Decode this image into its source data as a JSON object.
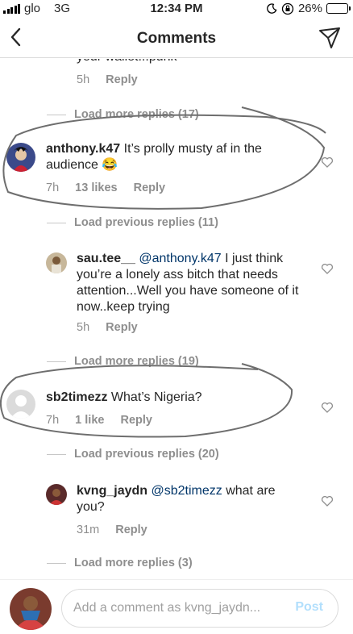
{
  "status_bar": {
    "carrier": "glo",
    "network": "3G",
    "time": "12:34 PM",
    "battery": "26%",
    "battery_level": 0.26
  },
  "header": {
    "title": "Comments"
  },
  "comments": [
    {
      "username": "",
      "text": "your wallet...punk",
      "time": "5h",
      "likes": "",
      "reply_label": "Reply"
    },
    {
      "username": "anthony.k47",
      "text": " It’s prolly musty af in the audience 😂",
      "time": "7h",
      "likes": "13 likes",
      "reply_label": "Reply"
    },
    {
      "username": "sau.tee__",
      "mention": "@anthony.k47",
      "text": " I just think you’re a lonely ass bitch that needs attention...Well you have someone of it now..keep trying",
      "time": "5h",
      "likes": "",
      "reply_label": "Reply"
    },
    {
      "username": "sb2timezz",
      "text": " What’s Nigeria?",
      "time": "7h",
      "likes": "1 like",
      "reply_label": "Reply"
    },
    {
      "username": "kvng_jaydn",
      "mention": "@sb2timezz",
      "text": " what are you?",
      "time": "31m",
      "likes": "",
      "reply_label": "Reply"
    }
  ],
  "thread_links": [
    "Load more replies (17)",
    "Load previous replies (11)",
    "Load more replies (19)",
    "Load previous replies (20)",
    "Load more replies (3)"
  ],
  "composer": {
    "placeholder": "Add a comment as kvng_jaydn...",
    "post_label": "Post"
  },
  "colors": {
    "text": "#262626",
    "muted": "#8e8e8e",
    "mention": "#003569",
    "post_disabled": "#b2dffc",
    "battery_fill": "#f2c514"
  }
}
